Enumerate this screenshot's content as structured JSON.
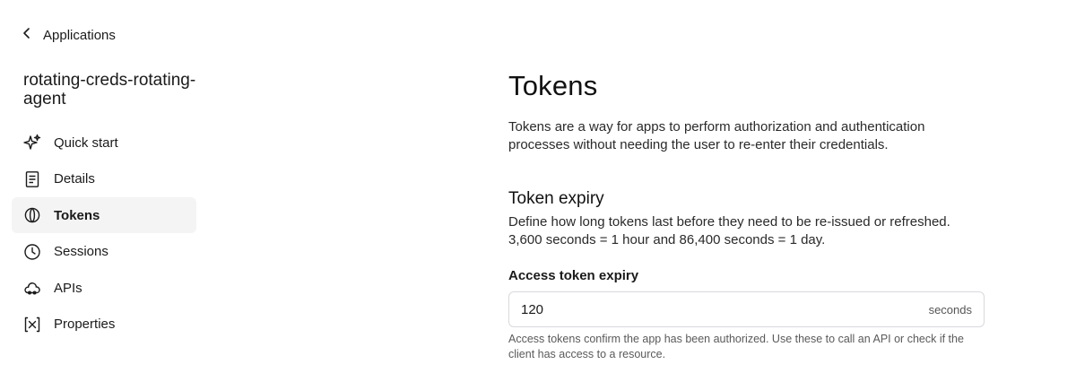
{
  "back": {
    "label": "Applications",
    "icon": "chevron-left-icon"
  },
  "app": {
    "name": "rotating-creds-rotating-agent"
  },
  "sidebar": {
    "items": [
      {
        "label": "Quick start",
        "icon": "sparkles-icon",
        "active": false
      },
      {
        "label": "Details",
        "icon": "document-icon",
        "active": false
      },
      {
        "label": "Tokens",
        "icon": "token-icon",
        "active": true
      },
      {
        "label": "Sessions",
        "icon": "clock-icon",
        "active": false
      },
      {
        "label": "APIs",
        "icon": "cloud-icon",
        "active": false
      },
      {
        "label": "Properties",
        "icon": "variable-icon",
        "active": false
      }
    ]
  },
  "main": {
    "title": "Tokens",
    "intro": "Tokens are a way for apps to perform authorization and authentication processes without needing the user to re-enter their credentials.",
    "expiry": {
      "title": "Token expiry",
      "description": "Define how long tokens last before they need to be re-issued or refreshed. 3,600 seconds = 1 hour and 86,400 seconds = 1 day."
    },
    "access_token": {
      "label": "Access token expiry",
      "value": "120",
      "unit": "seconds",
      "help": "Access tokens confirm the app has been authorized. Use these to call an API or check if the client has access to a resource."
    }
  },
  "colors": {
    "active_bg": "#f4f4f5",
    "text": "#1a1a1a",
    "muted": "#5a5a5a",
    "border": "#d9d9de"
  }
}
